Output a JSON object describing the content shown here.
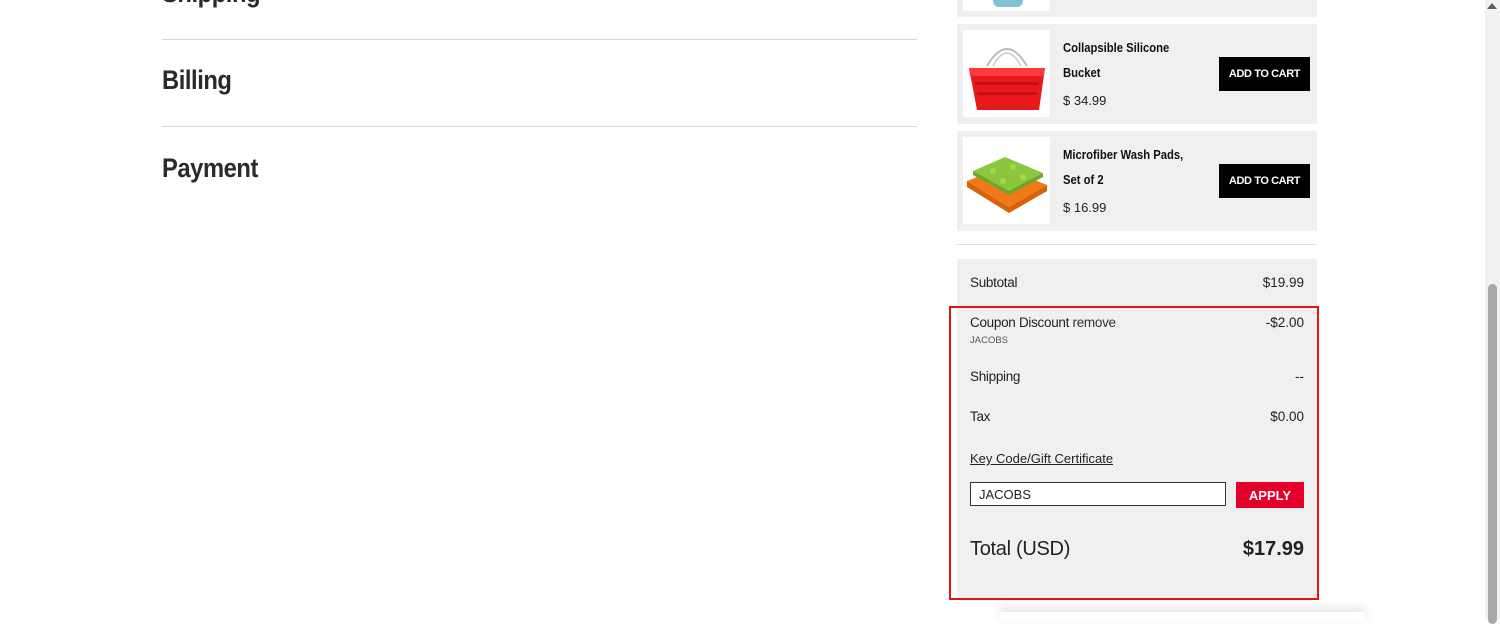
{
  "checkout": {
    "sections": [
      "Shipping",
      "Billing",
      "Payment"
    ]
  },
  "recommendations": [
    {
      "name": "Collapsible Silicone Bucket",
      "price": "$ 34.99",
      "button": "ADD TO CART",
      "image": "red-bucket-image"
    },
    {
      "name": "Microfiber Wash Pads, Set of 2",
      "price": "$ 16.99",
      "button": "ADD TO CART",
      "image": "wash-pads-image"
    }
  ],
  "summary": {
    "subtotal_label": "Subtotal",
    "subtotal_value": "$19.99",
    "coupon_label": "Coupon Discount",
    "coupon_remove": "remove",
    "coupon_code": "JACOBS",
    "coupon_value": "-$2.00",
    "shipping_label": "Shipping",
    "shipping_value": "--",
    "tax_label": "Tax",
    "tax_value": "$0.00",
    "keycode_label": "Key Code/Gift Certificate",
    "keycode_input_value": "JACOBS",
    "apply_label": "APPLY",
    "total_label": "Total (USD)",
    "total_value": "$17.99"
  },
  "colors": {
    "accent": "#e4002b",
    "highlight": "#e31414",
    "panel": "#f0f0f0"
  }
}
